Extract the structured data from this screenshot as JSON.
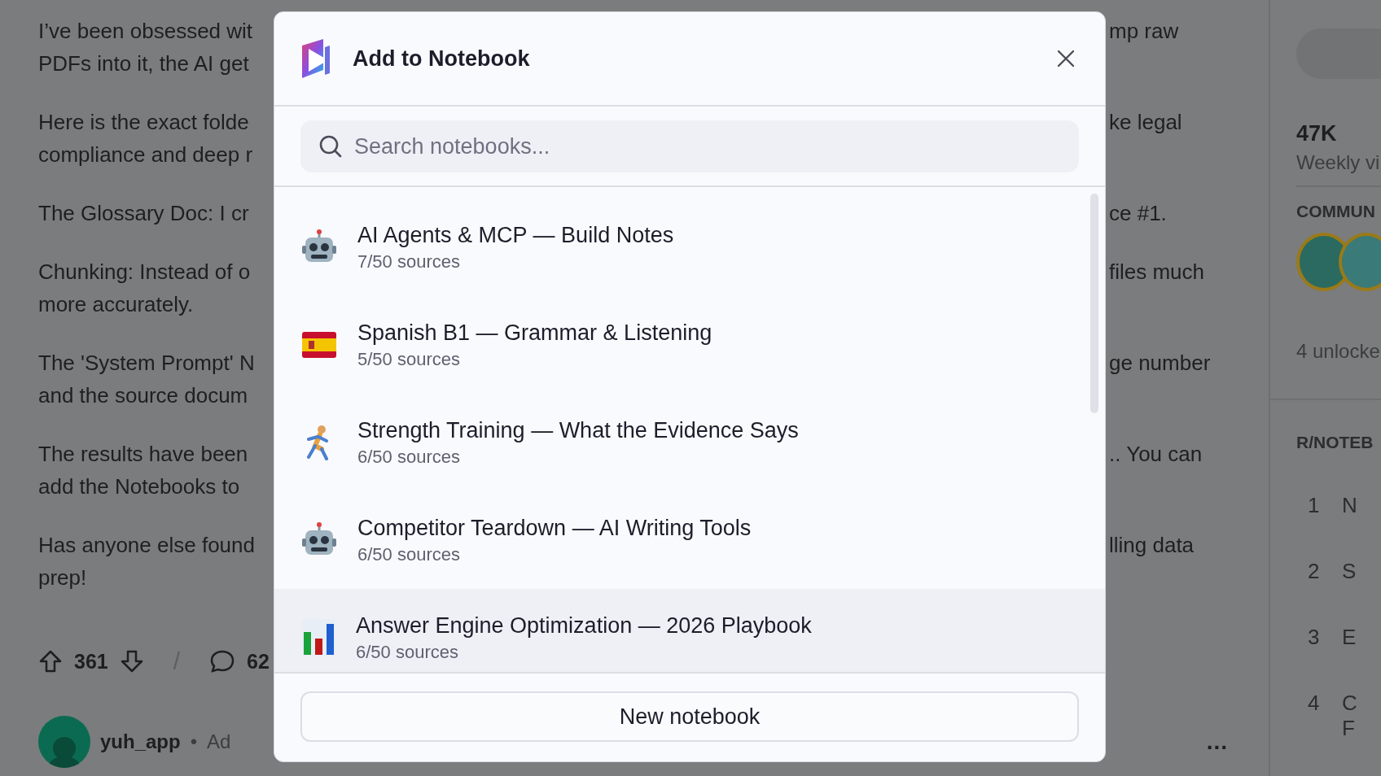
{
  "post": {
    "paragraphs": [
      {
        "lines": [
          {
            "left": "I’ve been obsessed wit",
            "right": "mp raw"
          },
          {
            "left": "PDFs into it, the AI get"
          }
        ]
      },
      {
        "lines": [
          {
            "left": "Here is the exact folde",
            "right": "ke legal"
          },
          {
            "left": "compliance and deep r"
          }
        ]
      },
      {
        "lines": [
          {
            "left": "The Glossary Doc: I cr",
            "right": "ce #1."
          }
        ]
      },
      {
        "lines": [
          {
            "left": "Chunking: Instead of o",
            "right": "files much"
          },
          {
            "left": "more accurately."
          }
        ]
      },
      {
        "lines": [
          {
            "left": "The 'System Prompt' N",
            "right": "ge number"
          },
          {
            "left": "and the source docum"
          }
        ]
      },
      {
        "lines": [
          {
            "left": "The results have been",
            "right": ".. You can"
          },
          {
            "left": "add the Notebooks to"
          }
        ]
      },
      {
        "lines": [
          {
            "left": "Has anyone else found",
            "right": "lling data"
          },
          {
            "left": "prep!"
          }
        ]
      }
    ],
    "upvotes": "361",
    "separator": "/",
    "comments": "62"
  },
  "ad": {
    "user": "yuh_app",
    "dot": "•",
    "label": "Ad",
    "more": "..."
  },
  "sidebar": {
    "stat_value": "47K",
    "stat_label": "Weekly vi",
    "section": "COMMUN",
    "unlocked": "4 unlocke",
    "list_title": "R/NOTEB",
    "ranks": [
      {
        "number": "1",
        "text": "N"
      },
      {
        "number": "2",
        "text": "S"
      },
      {
        "number": "3",
        "text": "E"
      },
      {
        "number": "4",
        "text": "C",
        "text2": "F"
      }
    ]
  },
  "dialog": {
    "title": "Add to Notebook",
    "search": {
      "placeholder": "Search notebooks..."
    },
    "notebooks": [
      {
        "kind": "robot",
        "name": "AI Agents & MCP — Build Notes",
        "sources": "7/50 sources",
        "highlighted": false
      },
      {
        "kind": "flag",
        "name": "Spanish B1 — Grammar & Listening",
        "sources": "5/50 sources",
        "highlighted": false
      },
      {
        "kind": "runner",
        "name": "Strength Training — What the Evidence Says",
        "sources": "6/50 sources",
        "highlighted": false
      },
      {
        "kind": "robot",
        "name": "Competitor Teardown — AI Writing Tools",
        "sources": "6/50 sources",
        "highlighted": false
      },
      {
        "kind": "chart",
        "name": "Answer Engine Optimization — 2026 Playbook",
        "sources": "6/50 sources",
        "highlighted": true
      }
    ],
    "button": "New notebook"
  }
}
